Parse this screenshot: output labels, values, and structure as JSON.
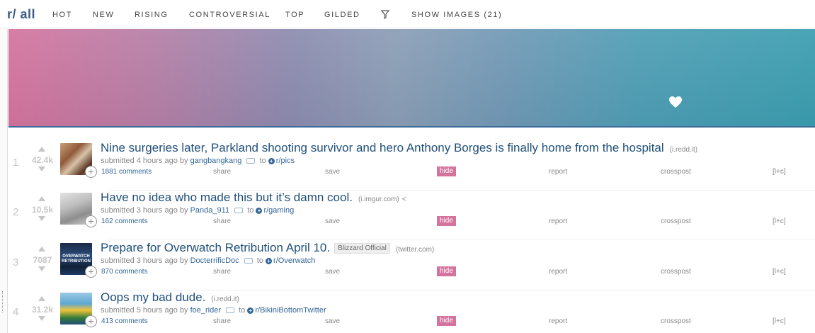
{
  "header": {
    "subreddit": "r/ all",
    "tabs": [
      {
        "label": "HOT"
      },
      {
        "label": "NEW"
      },
      {
        "label": "RISING"
      },
      {
        "label": "CONTROVERSIAL"
      },
      {
        "label": "TOP"
      },
      {
        "label": "GILDED"
      }
    ],
    "show_images": "SHOW IMAGES (21)",
    "filter_icon": "funnel-icon"
  },
  "banner": {
    "icon": "heart-icon",
    "colors": [
      "#d4739d",
      "#8c8aaf",
      "#3a9daf"
    ]
  },
  "posts": [
    {
      "rank": "1",
      "score": "42.4k",
      "title": "Nine surgeries later, Parkland shooting survivor and hero Anthony Borges is finally home from the hospital",
      "domain": "(i.redd.it)",
      "flair": "",
      "submitted": "submitted 4 hours ago by",
      "author": "gangbangkang",
      "to": "to",
      "subreddit": "r/pics",
      "comments": "1881 comments",
      "thumb_text": ""
    },
    {
      "rank": "2",
      "score": "10.5k",
      "title": "Have no idea who made this but it’s damn cool.",
      "domain": "(i.imgur.com)",
      "flair": "",
      "submitted": "submitted 3 hours ago by",
      "author": "Panda_911",
      "to": "to",
      "subreddit": "r/gaming",
      "comments": "162 comments",
      "thumb_text": ""
    },
    {
      "rank": "3",
      "score": "7087",
      "title": "Prepare for Overwatch Retribution April 10.",
      "domain": "(twitter.com)",
      "flair": "Blizzard Official",
      "submitted": "submitted 3 hours ago by",
      "author": "DocterrificDoc",
      "to": "to",
      "subreddit": "r/Overwatch",
      "comments": "870 comments",
      "thumb_text": "OVERWATCH RETRIBUTION"
    },
    {
      "rank": "4",
      "score": "31.2k",
      "title": "Oops my bad dude.",
      "domain": "(i.redd.it)",
      "flair": "",
      "submitted": "submitted 5 hours ago by",
      "author": "foe_rider",
      "to": "to",
      "subreddit": "r/BikiniBottomTwitter",
      "comments": "413 comments",
      "thumb_text": ""
    }
  ],
  "actions": {
    "share": "share",
    "save": "save",
    "hide": "hide",
    "report": "report",
    "crosspost": "crosspost",
    "lc": "[l+c]"
  },
  "colors": {
    "accent": "#336699",
    "hide_bg": "#d4739d",
    "title": "#1f4f7a"
  }
}
